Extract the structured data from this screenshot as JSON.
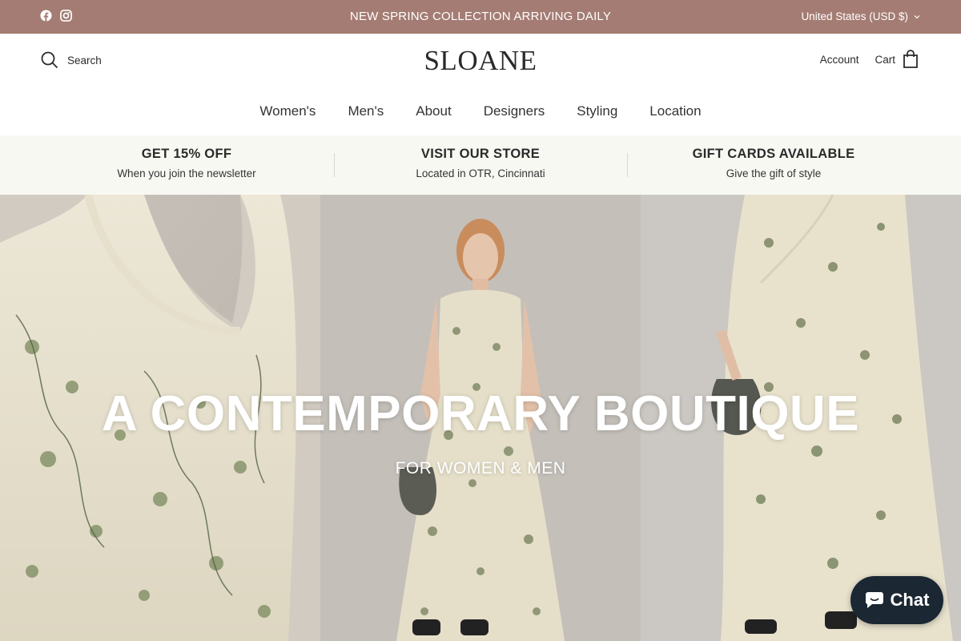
{
  "announcement": {
    "social": [
      {
        "icon": "facebook-icon"
      },
      {
        "icon": "instagram-icon"
      }
    ],
    "message": "NEW SPRING COLLECTION ARRIVING DAILY",
    "currency": "United States (USD $)",
    "background": "#a47c73"
  },
  "header": {
    "search_label": "Search",
    "logo": "SLOANE",
    "account_label": "Account",
    "cart_label": "Cart"
  },
  "nav": {
    "items": [
      "Women's",
      "Men's",
      "About",
      "Designers",
      "Styling",
      "Location"
    ]
  },
  "promo": [
    {
      "title": "GET 15% OFF",
      "subtitle": "When you join the newsletter"
    },
    {
      "title": "VISIT OUR STORE",
      "subtitle": "Located in OTR, Cincinnati"
    },
    {
      "title": "GIFT CARDS AVAILABLE",
      "subtitle": "Give the gift of style"
    }
  ],
  "hero": {
    "headline": "A CONTEMPORARY BOUTIQUE",
    "subheadline": "FOR WOMEN & MEN"
  },
  "chat": {
    "label": "Chat",
    "background": "#1b2732"
  }
}
